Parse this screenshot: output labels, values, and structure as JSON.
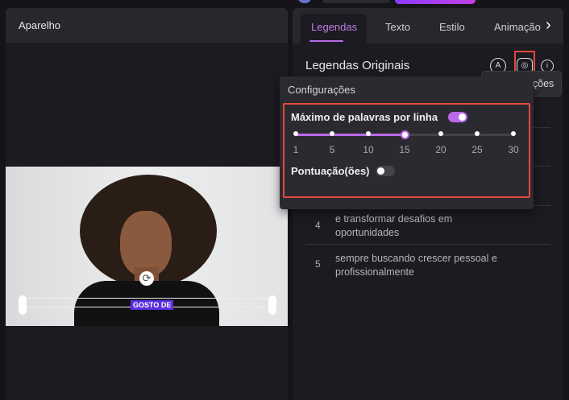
{
  "left_panel": {
    "title": "Aparelho",
    "caption_overlay": "GOSTO DE"
  },
  "right_panel": {
    "tabs": [
      {
        "label": "Legendas",
        "active": true
      },
      {
        "label": "Texto"
      },
      {
        "label": "Estilo"
      },
      {
        "label": "Animação"
      }
    ],
    "section_title": "Legendas Originais",
    "icons": [
      "auto-caption-icon",
      "settings-icon",
      "info-icon"
    ],
    "subtitles": [
      {
        "index": "4",
        "text": "e transformar desafios em oportunidades"
      },
      {
        "index": "5",
        "text": "sempre buscando crescer pessoal e profissionalmente"
      }
    ]
  },
  "tooltip": "Configurações",
  "settings_popup": {
    "title": "Configurações",
    "max_words": {
      "label": "Máximo de palavras por linha",
      "enabled": true,
      "value": 15,
      "ticks": [
        "1",
        "5",
        "10",
        "15",
        "20",
        "25",
        "30"
      ]
    },
    "punctuation": {
      "label": "Pontuação(ões)",
      "enabled": false
    }
  },
  "colors": {
    "accent": "#b86ae8",
    "highlight_box": "#e5483e",
    "caption_bg": "#5b2de0"
  }
}
